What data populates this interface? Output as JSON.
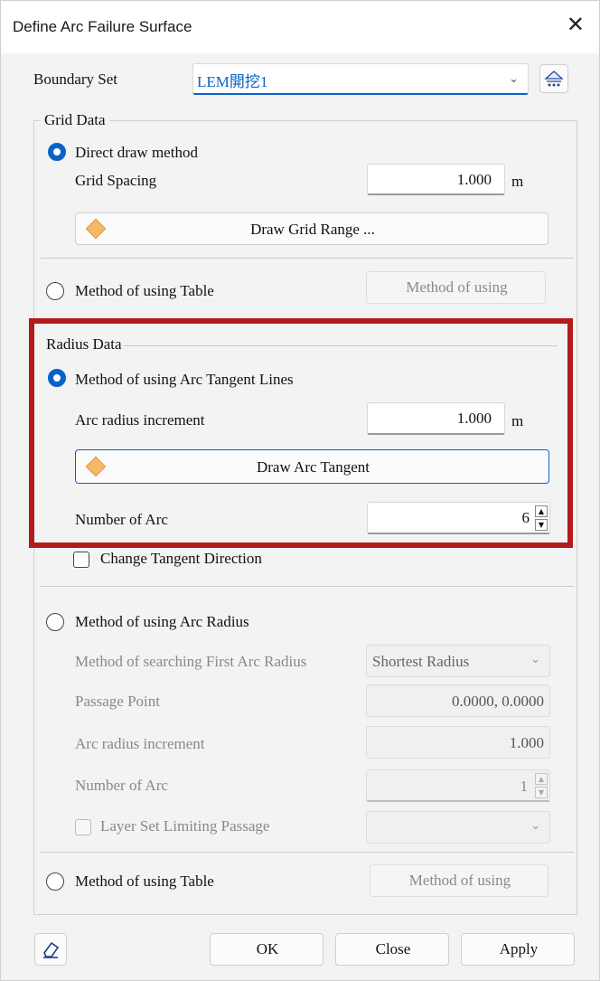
{
  "window": {
    "title": "Define Arc Failure Surface"
  },
  "boundary": {
    "label": "Boundary Set",
    "value": "LEM開挖1"
  },
  "grid_data": {
    "legend": "Grid Data",
    "direct_draw_label": "Direct draw method",
    "grid_spacing_label": "Grid Spacing",
    "grid_spacing_value": "1.000",
    "grid_spacing_unit": "m",
    "draw_grid_button": "Draw Grid Range ...",
    "table_method_label": "Method of using Table",
    "table_method_button": "Method of using"
  },
  "radius_data": {
    "legend": "Radius Data",
    "tangent_method_label": "Method of using Arc Tangent Lines",
    "arc_increment_label": "Arc radius increment",
    "arc_increment_value": "1.000",
    "arc_increment_unit": "m",
    "draw_tangent_button": "Draw Arc Tangent",
    "number_of_arc_label": "Number of Arc",
    "number_of_arc_value": "6",
    "change_direction_label": "Change Tangent Direction",
    "arc_radius_method_label": "Method of using Arc Radius",
    "search_first_label": "Method of searching First Arc Radius",
    "search_first_value": "Shortest Radius",
    "passage_point_label": "Passage Point",
    "passage_point_value": "0.0000, 0.0000",
    "increment2_label": "Arc radius increment",
    "increment2_value": "1.000",
    "number2_label": "Number of Arc",
    "number2_value": "1",
    "layer_set_label": "Layer Set Limiting Passage",
    "table_method_label": "Method of using Table",
    "table_method_button": "Method of using"
  },
  "footer": {
    "ok": "OK",
    "close": "Close",
    "apply": "Apply"
  },
  "icons": {
    "close": "close-icon",
    "boundary": "boundary-set-icon",
    "draw": "diamond-icon",
    "eraser": "eraser-icon"
  },
  "colors": {
    "accent": "#0a62c9",
    "highlight": "#b31b1b"
  }
}
